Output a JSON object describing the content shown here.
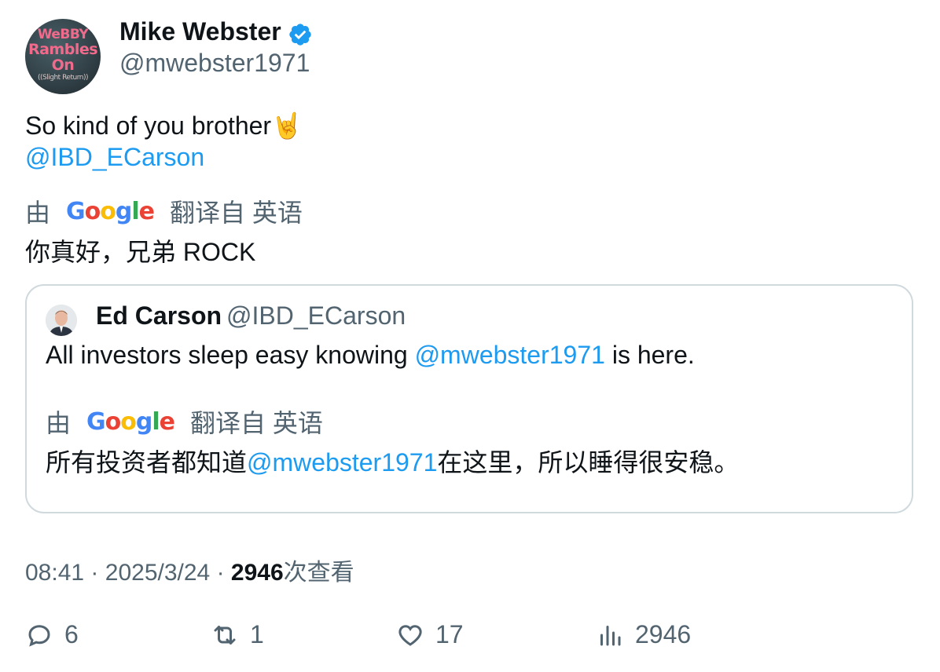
{
  "author": {
    "name": "Mike Webster",
    "handle": "@mwebster1971",
    "avatar_text": [
      "WeBBY",
      "Rambles",
      "On",
      "((Slight Return))"
    ],
    "verified_color": "#1d9bf0"
  },
  "tweet": {
    "text": "So kind of you brother🤘",
    "mention": "@IBD_ECarson",
    "translated_by": "由",
    "translated_from": "翻译自 英语",
    "google_letters": [
      "G",
      "o",
      "o",
      "g",
      "l",
      "e"
    ],
    "translation": "你真好，兄弟 ROCK"
  },
  "quote": {
    "name": "Ed Carson",
    "handle": "@IBD_ECarson",
    "text_before": "All investors sleep easy knowing ",
    "text_mention": "@mwebster1971",
    "text_after": " is here.",
    "translated_by": "由",
    "translated_from": "翻译自 英语",
    "translation_before": "所有投资者都知道",
    "translation_mention": "@mwebster1971",
    "translation_after": "在这里，所以睡得很安稳。"
  },
  "meta": {
    "time": "08:41",
    "separator": "·",
    "date": "2025/3/24",
    "views_count": "2946",
    "views_label": "次查看"
  },
  "actions": {
    "replies": "6",
    "retweets": "1",
    "likes": "17",
    "views": "2946"
  },
  "colors": {
    "link": "#1d9bf0",
    "muted": "#536471",
    "text": "#0f1419",
    "border": "#cfd9de"
  }
}
